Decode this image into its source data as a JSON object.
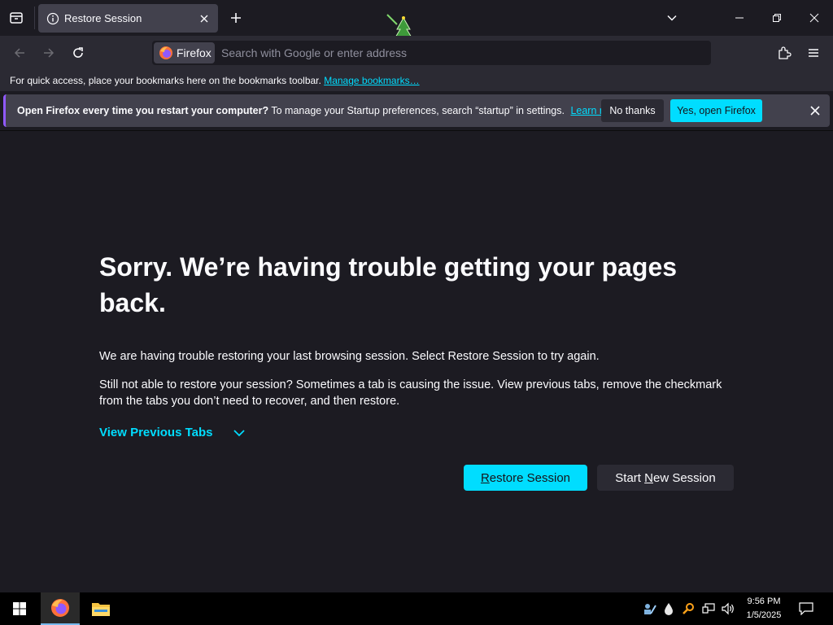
{
  "tab": {
    "title": "Restore Session"
  },
  "urlbar": {
    "identity_label": "Firefox",
    "placeholder": "Search with Google or enter address"
  },
  "bookmarks": {
    "text": "For quick access, place your bookmarks here on the bookmarks toolbar.",
    "link": "Manage bookmarks…"
  },
  "notification": {
    "bold": "Open Firefox every time you restart your computer?",
    "text": " To manage your Startup preferences, search “startup” in settings.",
    "link": "Learn more",
    "no_thanks": "No thanks",
    "yes_open": "Yes, open Firefox"
  },
  "main": {
    "title": "Sorry. We’re having trouble getting your pages back.",
    "para1": "We are having trouble restoring your last browsing session. Select Restore Session to try again.",
    "para2": "Still not able to restore your session? Sometimes a tab is causing the issue. View previous tabs, remove the checkmark from the tabs you don’t need to recover, and then restore.",
    "view_previous": "View Previous Tabs",
    "restore_button": {
      "accel": "R",
      "rest": "estore Session"
    },
    "start_new_button": {
      "before": "Start ",
      "accel": "N",
      "after": "ew Session"
    }
  },
  "taskbar": {
    "time": "9:56 PM",
    "date": "1/5/2025"
  },
  "colors": {
    "accent": "#00ddff",
    "background": "#1c1b22",
    "toolbar": "#2b2a33",
    "tab": "#42414d"
  },
  "icons": [
    "tab-list-icon",
    "info-icon",
    "close-icon",
    "plus-icon",
    "chevron-down-icon",
    "minimize-icon",
    "restore-icon",
    "back-icon",
    "forward-icon",
    "reload-icon",
    "firefox-icon",
    "star-icon",
    "extensions-icon",
    "menu-icon",
    "windows-start-icon",
    "folder-icon",
    "notification-icon"
  ]
}
